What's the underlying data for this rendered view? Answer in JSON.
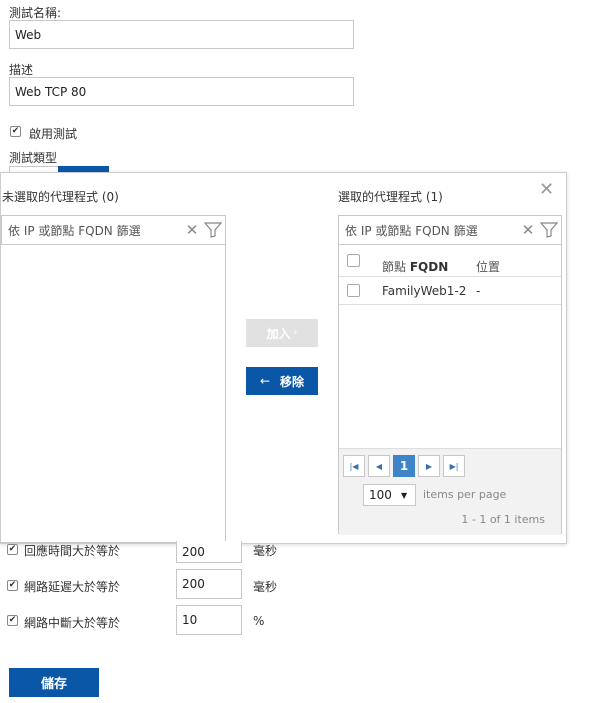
{
  "form": {
    "test_name_label": "測試名稱:",
    "test_name_value": "Web",
    "description_label": "描述",
    "description_value": "Web TCP 80",
    "enable_test_label": "啟用測試",
    "test_type_label": "測試類型"
  },
  "modal": {
    "unselected_title": "未選取的代理程式 (0)",
    "selected_title": "選取的代理程式 (1)",
    "filter_placeholder": "依 IP 或節點 FQDN 篩選",
    "add_label": "加入",
    "remove_label": "移除",
    "columns": {
      "node_prefix": "節點 ",
      "node_bold": "FQDN",
      "location": "位置"
    },
    "rows": [
      {
        "node": "FamilyWeb1-2",
        "location": "-"
      }
    ],
    "pager": {
      "current_page": "1",
      "page_size": "100",
      "items_per_page_label": "items per page",
      "summary": "1 - 1 of 1 items"
    }
  },
  "thresholds": [
    {
      "label": "回應時間大於等於",
      "value": "200",
      "unit": "毫秒"
    },
    {
      "label": "網路延遲大於等於",
      "value": "200",
      "unit": "毫秒"
    },
    {
      "label": "網路中斷大於等於",
      "value": "10",
      "unit": "%"
    }
  ],
  "save_label": "儲存",
  "colors": {
    "primary": "#0a57a8",
    "disabled": "#e1e1e1",
    "page_active": "#3f84c9"
  }
}
